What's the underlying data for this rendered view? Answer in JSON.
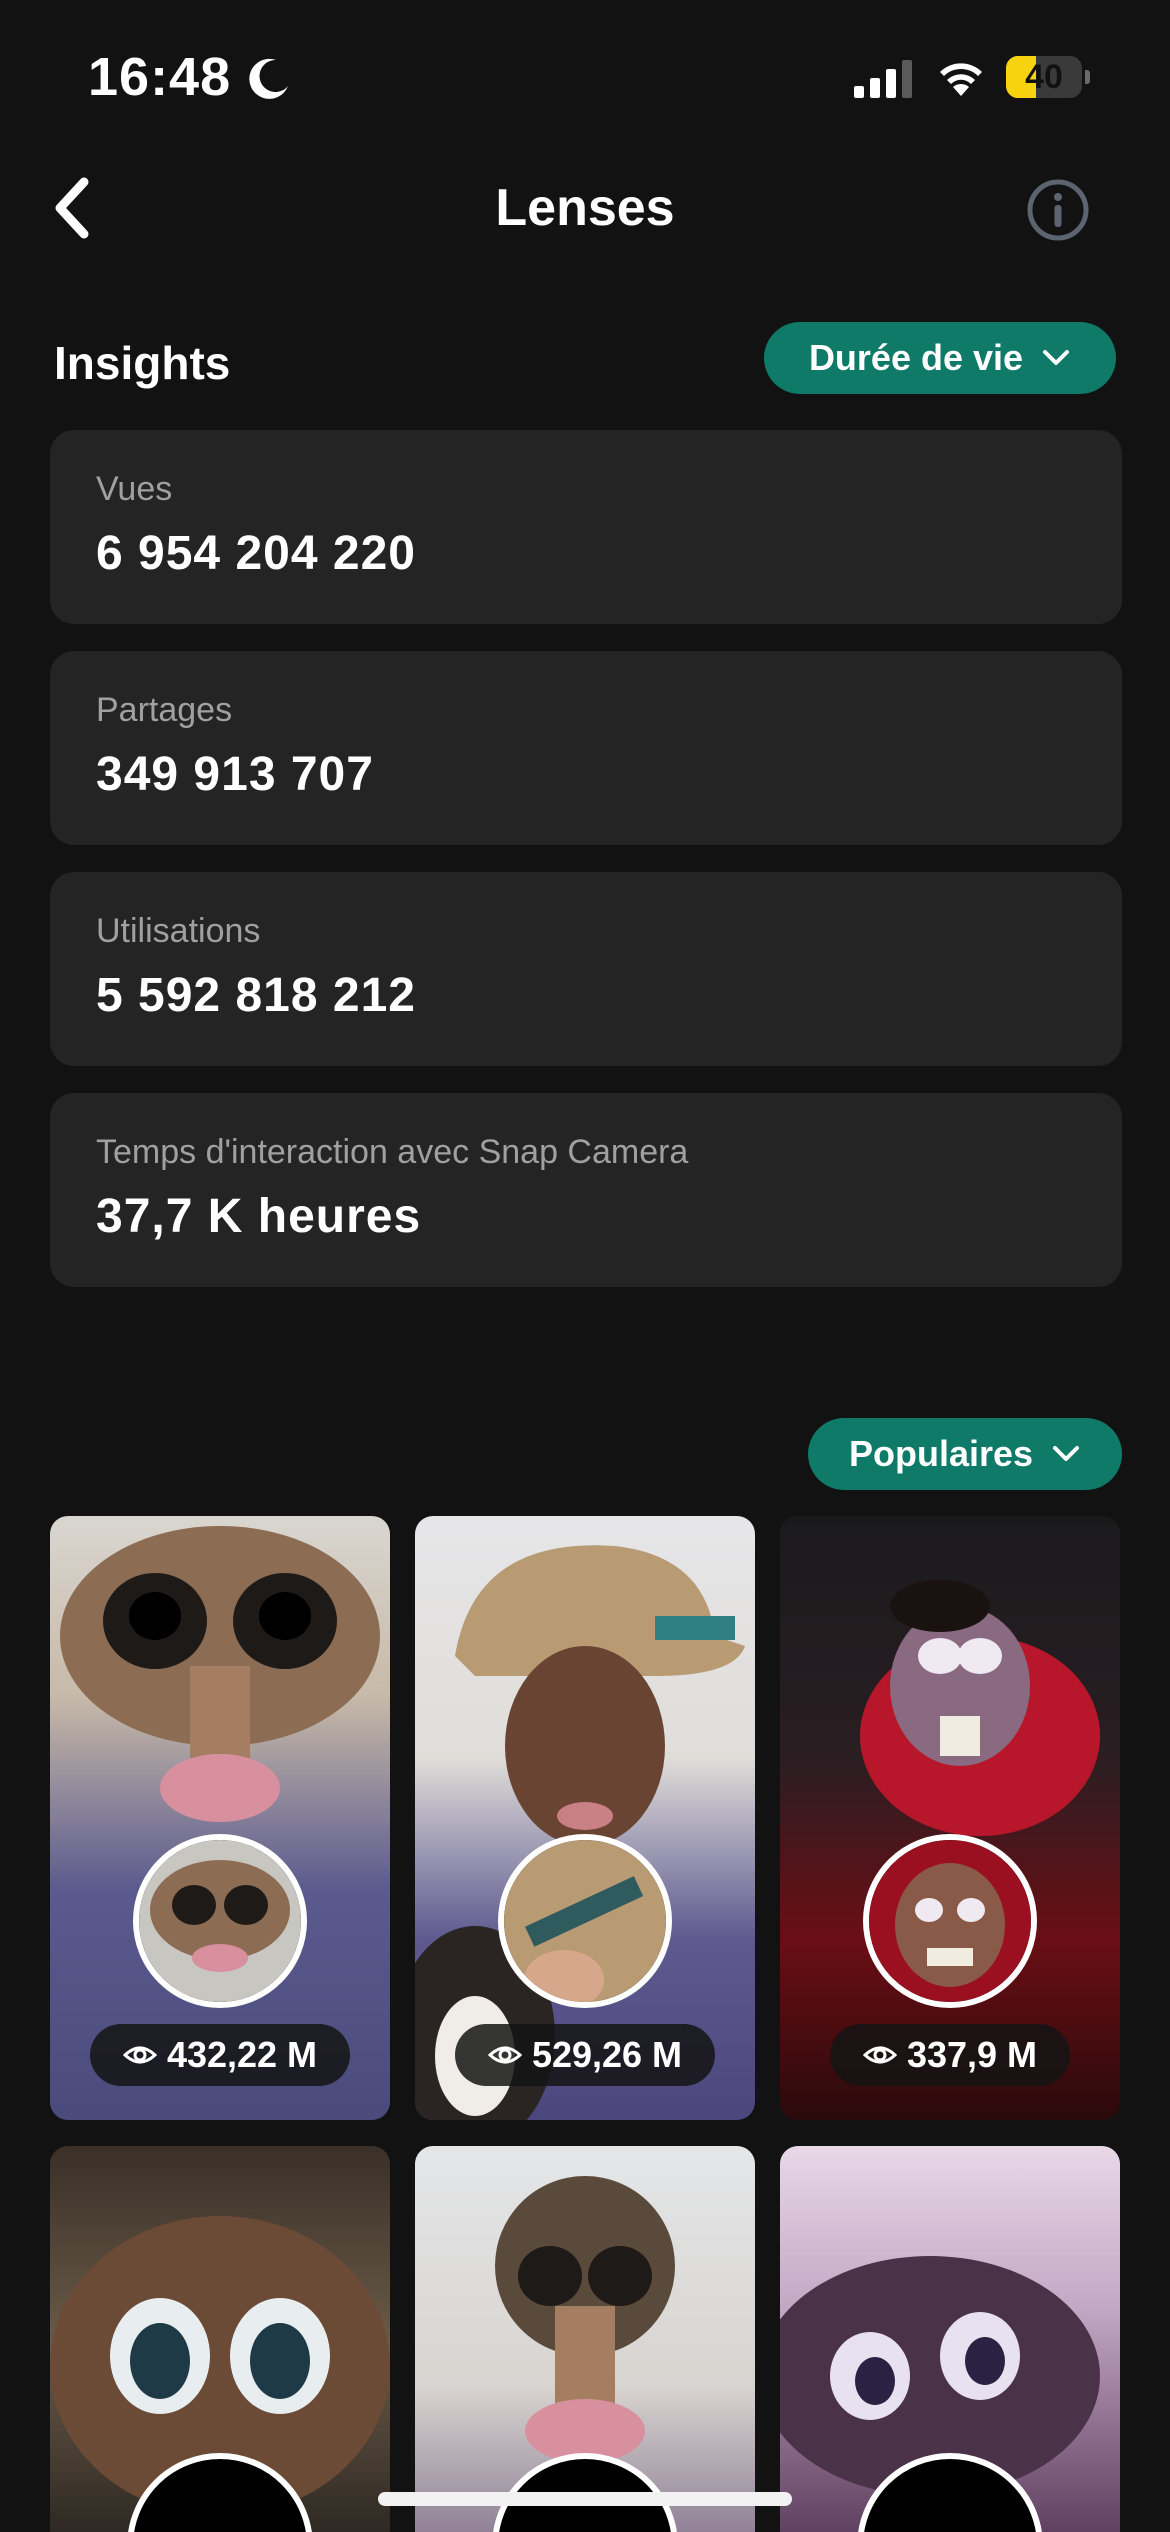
{
  "status_bar": {
    "time": "16:48",
    "battery_level": "40",
    "battery_fraction": 0.4,
    "icons": [
      "moon-icon",
      "signal-icon",
      "wifi-icon",
      "battery-icon"
    ]
  },
  "nav": {
    "title": "Lenses",
    "back_icon": "chevron-left-icon",
    "info_icon": "info-icon"
  },
  "insights": {
    "title": "Insights",
    "period_filter": "Durée de vie",
    "stats": [
      {
        "label": "Vues",
        "value": "6 954 204 220"
      },
      {
        "label": "Partages",
        "value": "349 913 707"
      },
      {
        "label": "Utilisations",
        "value": "5 592 818 212"
      },
      {
        "label": "Temps d'interaction avec Snap Camera",
        "value": "37,7 K heures"
      }
    ]
  },
  "lenses": {
    "sort_filter": "Populaires",
    "items": [
      {
        "views": "432,22 M"
      },
      {
        "views": "529,26 M"
      },
      {
        "views": "337,9 M"
      },
      {
        "views": ""
      },
      {
        "views": ""
      },
      {
        "views": ""
      }
    ]
  },
  "colors": {
    "background": "#121212",
    "card": "#242424",
    "accent": "#0e7a67",
    "battery": "#f7d20f"
  }
}
